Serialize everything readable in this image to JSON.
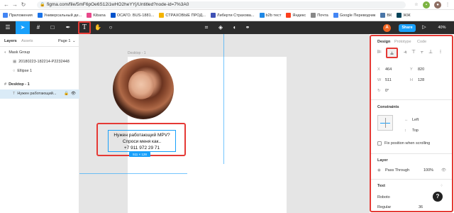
{
  "browser": {
    "url": "figma.com/file/5mF6pOe6S12i1wHO2heYYj/Untitled?node-id=7%3A0",
    "bookmarks": [
      {
        "label": "Приложения",
        "color": "#4285f4",
        "icon": "apps-grid-icon"
      },
      {
        "label": "Универсальный де...",
        "color": "#1a73e8",
        "icon": "doc-icon"
      },
      {
        "label": "Kibana",
        "color": "#e8488b",
        "icon": "kibana-icon"
      },
      {
        "label": "ОСАГО. BUS-1881...",
        "color": "#0052cc",
        "icon": "jira-icon"
      },
      {
        "label": "СТРАХОВЫЕ ПРОД...",
        "color": "#f4b400",
        "icon": "doc-icon"
      },
      {
        "label": "Либерти Страхова...",
        "color": "#3f51b5",
        "icon": "site-icon"
      },
      {
        "label": "b2b тест",
        "color": "#1e88e5",
        "icon": "site-icon"
      },
      {
        "label": "Яндекс",
        "color": "#fc3f1d",
        "icon": "yandex-icon"
      },
      {
        "label": "Почта",
        "color": "#888888",
        "icon": "mail-icon"
      },
      {
        "label": "Google Переводчик",
        "color": "#4285f4",
        "icon": "translate-icon"
      },
      {
        "label": "ВК",
        "color": "#4a76a8",
        "icon": "vk-icon"
      },
      {
        "label": "ЖЖ",
        "color": "#004359",
        "icon": "lj-icon"
      }
    ]
  },
  "toolbar": {
    "share_label": "Share",
    "zoom": "40%",
    "avatar_letter": "A"
  },
  "left_panel": {
    "tabs": {
      "layers": "Layers",
      "assets": "Assets",
      "page": "Page 1"
    },
    "layers": [
      {
        "label": "Mask Group",
        "indent": 0
      },
      {
        "label": "20180223-182214-P2232448",
        "indent": 1
      },
      {
        "label": "Ellipse 1",
        "indent": 1
      },
      {
        "label": "Desktop - 1",
        "indent": 0
      },
      {
        "label": "Нужен работающий...",
        "indent": 1
      }
    ]
  },
  "canvas": {
    "frame_label": "Desktop - 1",
    "text_lines": [
      "Нужен работающий MPV?",
      "Спроси меня как..",
      "+7 911 972 29 71"
    ],
    "size_badge": "511 × 128"
  },
  "right_panel": {
    "tabs": {
      "design": "Design",
      "prototype": "Prototype",
      "code": "Code"
    },
    "props": {
      "x": "464",
      "y": "820",
      "w": "511",
      "h": "128",
      "rotation": "0°"
    },
    "constraints_title": "Constraints",
    "constraint_h": "Left",
    "constraint_v": "Top",
    "fix_position": "Fix position when scrolling",
    "layer_title": "Layer",
    "blend": "Pass Through",
    "opacity": "100%",
    "text_title": "Text",
    "font": "Roboto",
    "weight": "Regular",
    "size": "36"
  },
  "colors": {
    "accent": "#18a0fb",
    "highlight": "#e53935",
    "toolbar": "#2c2c2c"
  }
}
